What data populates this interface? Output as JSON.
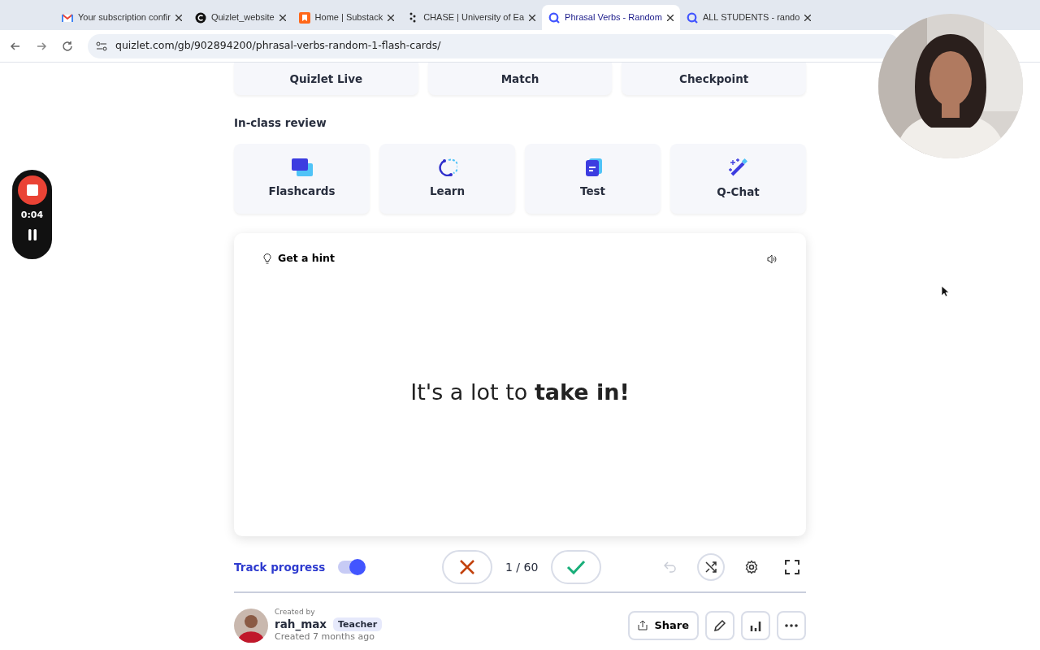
{
  "browser": {
    "tabs": [
      {
        "title": "Your subscription confir",
        "kind": "mail",
        "selected": false
      },
      {
        "title": "Quizlet_website",
        "kind": "circle",
        "selected": false
      },
      {
        "title": "Home | Substack",
        "kind": "bookmark",
        "selected": false
      },
      {
        "title": "CHASE | University of Ea",
        "kind": "dots",
        "selected": false
      },
      {
        "title": "Phrasal Verbs - Random",
        "kind": "q",
        "selected": true
      },
      {
        "title": "ALL STUDENTS - rando",
        "kind": "q",
        "selected": false
      }
    ],
    "url": "quizlet.com/gb/902894200/phrasal-verbs-random-1-flash-cards/"
  },
  "modes_top": [
    "Quizlet Live",
    "Match",
    "Checkpoint"
  ],
  "section_title": "In-class review",
  "modes": [
    {
      "label": "Flashcards",
      "kind": "flashcards"
    },
    {
      "label": "Learn",
      "kind": "learn"
    },
    {
      "label": "Test",
      "kind": "test"
    },
    {
      "label": "Q-Chat",
      "kind": "qchat"
    }
  ],
  "card": {
    "hint": "Get a hint",
    "text": "It's a lot to **take in!**"
  },
  "controls": {
    "track_progress": {
      "label": "Track progress",
      "on": true
    },
    "counter": "1 / 60",
    "undo_disabled": true
  },
  "creator": {
    "created_by": "Created by",
    "name": "rah_max",
    "role": "Teacher",
    "created": "Created 7 months ago",
    "share": "Share"
  },
  "recorder": {
    "time": "0:04"
  }
}
